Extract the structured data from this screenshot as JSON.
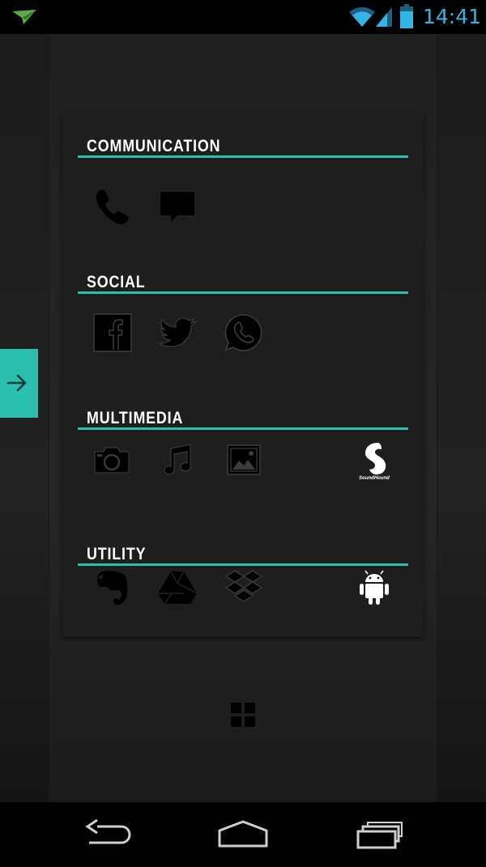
{
  "status_bar": {
    "time": "14:41",
    "accent": "#33b5e5"
  },
  "widget": {
    "accent": "#2bbfae",
    "sections": [
      {
        "title": "COMMUNICATION",
        "apps": [
          {
            "icon": "phone-icon"
          },
          {
            "icon": "message-icon"
          }
        ]
      },
      {
        "title": "SOCIAL",
        "apps": [
          {
            "icon": "facebook-icon"
          },
          {
            "icon": "twitter-icon"
          },
          {
            "icon": "whatsapp-icon"
          }
        ]
      },
      {
        "title": "MULTIMEDIA",
        "apps": [
          {
            "icon": "camera-icon"
          },
          {
            "icon": "music-icon"
          },
          {
            "icon": "gallery-icon"
          },
          {
            "icon": "soundhound-icon",
            "label": "SoundHound"
          }
        ]
      },
      {
        "title": "UTILITY",
        "apps": [
          {
            "icon": "evernote-icon"
          },
          {
            "icon": "google-drive-icon"
          },
          {
            "icon": "dropbox-icon"
          },
          {
            "icon": "android-icon"
          }
        ]
      }
    ]
  },
  "navigation": {
    "buttons": [
      "back",
      "home",
      "recents"
    ]
  }
}
